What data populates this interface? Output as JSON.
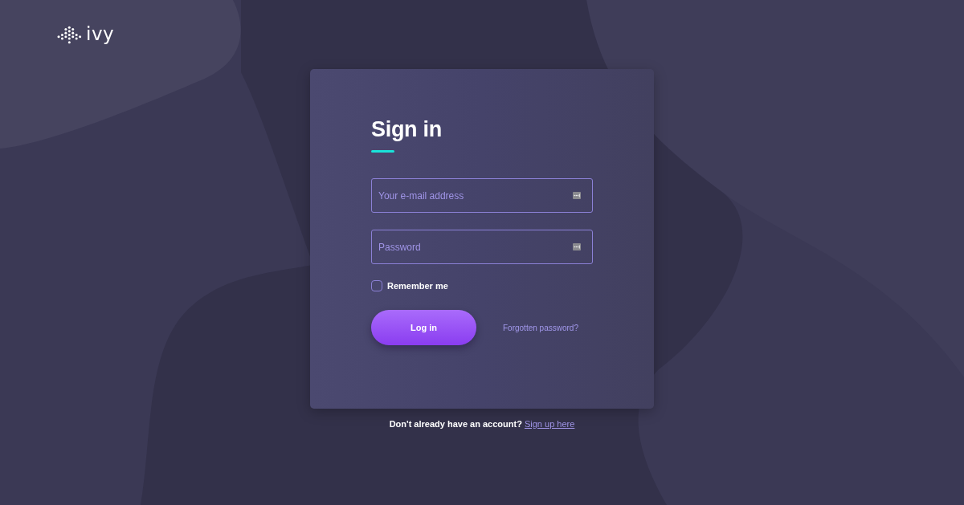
{
  "logo": {
    "text": "ivy"
  },
  "form": {
    "title": "Sign in",
    "fields": [
      {
        "placeholder": "Your e-mail address"
      },
      {
        "placeholder": "Password"
      }
    ],
    "remember": {
      "label": "Remember me",
      "checked": false
    },
    "submit": "Log in",
    "forgot_link": "Forgotten password?"
  },
  "footer": {
    "text": "Don't already have an account?",
    "link": "Sign up here"
  }
}
